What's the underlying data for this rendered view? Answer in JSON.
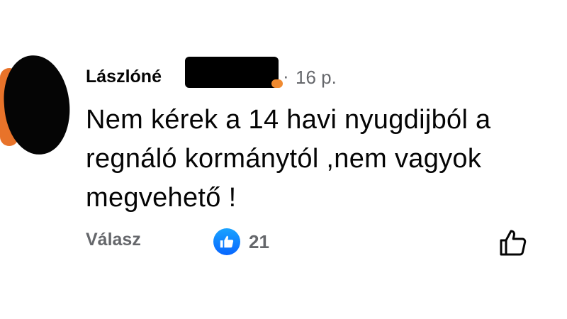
{
  "comment": {
    "author_name": "Lászlóné",
    "separator": "·",
    "timestamp": "16 p.",
    "text_lines": [
      "Nem kérek a 14 havi nyugdijból a",
      "regnáló kormánytól ,nem vagyok",
      "megvehető !"
    ]
  },
  "actions": {
    "reply_label": "Válasz",
    "like_count": "21",
    "like_badge_icon": "thumbs-up-icon",
    "like_action_icon": "thumbs-up-outline-icon"
  },
  "colors": {
    "text_primary": "#050505",
    "text_secondary": "#65676b",
    "like_blue": "#0766ff"
  }
}
